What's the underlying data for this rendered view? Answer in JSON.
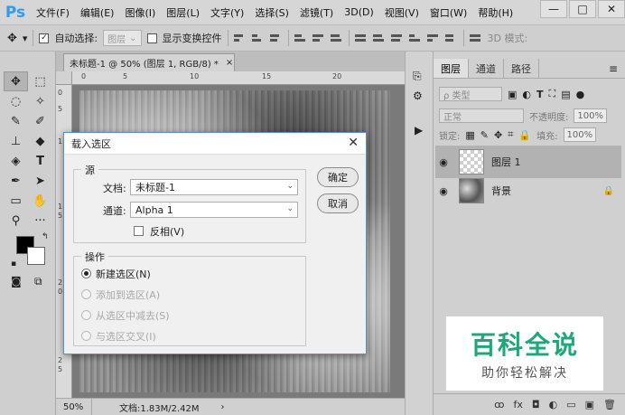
{
  "app": {
    "logo": "Ps"
  },
  "menu": [
    "文件(F)",
    "编辑(E)",
    "图像(I)",
    "图层(L)",
    "文字(Y)",
    "选择(S)",
    "滤镜(T)",
    "3D(D)",
    "视图(V)",
    "窗口(W)",
    "帮助(H)"
  ],
  "window_controls": {
    "minimize": "—",
    "restore": "□",
    "close": "✕"
  },
  "options_bar": {
    "auto_select_label": "自动选择:",
    "auto_select_checked": true,
    "auto_select_target": "图层",
    "show_transform_label": "显示变换控件",
    "show_transform_checked": false,
    "mode_3d": "3D 模式:"
  },
  "document": {
    "tab_title": "未标题-1 @ 50% (图层 1, RGB/8) *",
    "tab_close": "×",
    "zoom": "50%",
    "status": "文档:1.83M/2.42M",
    "ruler_h": [
      "0",
      "5",
      "10",
      "15",
      "20"
    ],
    "ruler_v": [
      "0",
      "5",
      "1",
      "1",
      "5",
      "2",
      "0",
      "2",
      "5"
    ]
  },
  "panels": {
    "tabs": [
      "图层",
      "通道",
      "路径"
    ],
    "active_tab": "图层",
    "filter_label": "ρ 类型",
    "blend_mode": "正常",
    "opacity_label": "不透明度:",
    "opacity_value": "100%",
    "lock_label": "锁定:",
    "fill_label": "填充:",
    "fill_value": "100%",
    "layers": [
      {
        "name": "图层 1",
        "selected": true,
        "thumb": "transparent",
        "locked": false
      },
      {
        "name": "背景",
        "selected": false,
        "thumb": "noise",
        "locked": true
      }
    ],
    "bottom_icons": [
      "link-icon",
      "fx-icon",
      "mask-icon",
      "adjustment-icon",
      "group-icon",
      "new-layer-icon",
      "trash-icon"
    ],
    "bottom_labels": [
      "ꝏ",
      "fx",
      "◘",
      "◐",
      "▭",
      "▣",
      "🗑"
    ]
  },
  "dialog": {
    "title": "载入选区",
    "close": "✕",
    "source_group": "源",
    "document_label": "文档:",
    "document_value": "未标题-1",
    "channel_label": "通道:",
    "channel_value": "Alpha 1",
    "invert_label": "反相(V)",
    "invert_checked": false,
    "operation_group": "操作",
    "operations": [
      {
        "label": "新建选区(N)",
        "selected": true,
        "enabled": true
      },
      {
        "label": "添加到选区(A)",
        "selected": false,
        "enabled": false
      },
      {
        "label": "从选区中减去(S)",
        "selected": false,
        "enabled": false
      },
      {
        "label": "与选区交叉(I)",
        "selected": false,
        "enabled": false
      }
    ],
    "ok_label": "确定",
    "cancel_label": "取消"
  },
  "watermark": {
    "title": "百科全说",
    "subtitle": "助你轻松解决"
  }
}
